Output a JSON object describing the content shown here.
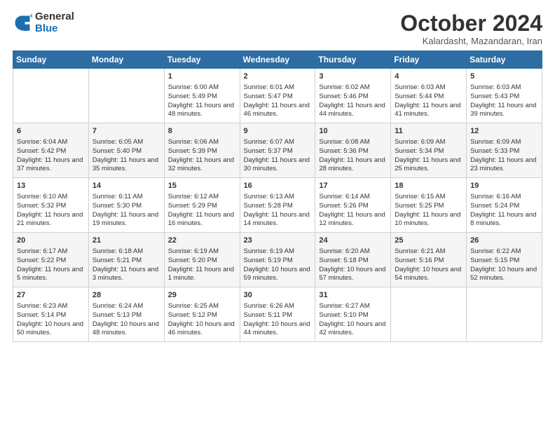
{
  "logo": {
    "general": "General",
    "blue": "Blue"
  },
  "header": {
    "month": "October 2024",
    "location": "Kalardasht, Mazandaran, Iran"
  },
  "weekdays": [
    "Sunday",
    "Monday",
    "Tuesday",
    "Wednesday",
    "Thursday",
    "Friday",
    "Saturday"
  ],
  "weeks": [
    [
      {
        "day": "",
        "sunrise": "",
        "sunset": "",
        "daylight": ""
      },
      {
        "day": "",
        "sunrise": "",
        "sunset": "",
        "daylight": ""
      },
      {
        "day": "1",
        "sunrise": "Sunrise: 6:00 AM",
        "sunset": "Sunset: 5:49 PM",
        "daylight": "Daylight: 11 hours and 48 minutes."
      },
      {
        "day": "2",
        "sunrise": "Sunrise: 6:01 AM",
        "sunset": "Sunset: 5:47 PM",
        "daylight": "Daylight: 11 hours and 46 minutes."
      },
      {
        "day": "3",
        "sunrise": "Sunrise: 6:02 AM",
        "sunset": "Sunset: 5:46 PM",
        "daylight": "Daylight: 11 hours and 44 minutes."
      },
      {
        "day": "4",
        "sunrise": "Sunrise: 6:03 AM",
        "sunset": "Sunset: 5:44 PM",
        "daylight": "Daylight: 11 hours and 41 minutes."
      },
      {
        "day": "5",
        "sunrise": "Sunrise: 6:03 AM",
        "sunset": "Sunset: 5:43 PM",
        "daylight": "Daylight: 11 hours and 39 minutes."
      }
    ],
    [
      {
        "day": "6",
        "sunrise": "Sunrise: 6:04 AM",
        "sunset": "Sunset: 5:42 PM",
        "daylight": "Daylight: 11 hours and 37 minutes."
      },
      {
        "day": "7",
        "sunrise": "Sunrise: 6:05 AM",
        "sunset": "Sunset: 5:40 PM",
        "daylight": "Daylight: 11 hours and 35 minutes."
      },
      {
        "day": "8",
        "sunrise": "Sunrise: 6:06 AM",
        "sunset": "Sunset: 5:39 PM",
        "daylight": "Daylight: 11 hours and 32 minutes."
      },
      {
        "day": "9",
        "sunrise": "Sunrise: 6:07 AM",
        "sunset": "Sunset: 5:37 PM",
        "daylight": "Daylight: 11 hours and 30 minutes."
      },
      {
        "day": "10",
        "sunrise": "Sunrise: 6:08 AM",
        "sunset": "Sunset: 5:36 PM",
        "daylight": "Daylight: 11 hours and 28 minutes."
      },
      {
        "day": "11",
        "sunrise": "Sunrise: 6:09 AM",
        "sunset": "Sunset: 5:34 PM",
        "daylight": "Daylight: 11 hours and 25 minutes."
      },
      {
        "day": "12",
        "sunrise": "Sunrise: 6:09 AM",
        "sunset": "Sunset: 5:33 PM",
        "daylight": "Daylight: 11 hours and 23 minutes."
      }
    ],
    [
      {
        "day": "13",
        "sunrise": "Sunrise: 6:10 AM",
        "sunset": "Sunset: 5:32 PM",
        "daylight": "Daylight: 11 hours and 21 minutes."
      },
      {
        "day": "14",
        "sunrise": "Sunrise: 6:11 AM",
        "sunset": "Sunset: 5:30 PM",
        "daylight": "Daylight: 11 hours and 19 minutes."
      },
      {
        "day": "15",
        "sunrise": "Sunrise: 6:12 AM",
        "sunset": "Sunset: 5:29 PM",
        "daylight": "Daylight: 11 hours and 16 minutes."
      },
      {
        "day": "16",
        "sunrise": "Sunrise: 6:13 AM",
        "sunset": "Sunset: 5:28 PM",
        "daylight": "Daylight: 11 hours and 14 minutes."
      },
      {
        "day": "17",
        "sunrise": "Sunrise: 6:14 AM",
        "sunset": "Sunset: 5:26 PM",
        "daylight": "Daylight: 11 hours and 12 minutes."
      },
      {
        "day": "18",
        "sunrise": "Sunrise: 6:15 AM",
        "sunset": "Sunset: 5:25 PM",
        "daylight": "Daylight: 11 hours and 10 minutes."
      },
      {
        "day": "19",
        "sunrise": "Sunrise: 6:16 AM",
        "sunset": "Sunset: 5:24 PM",
        "daylight": "Daylight: 11 hours and 8 minutes."
      }
    ],
    [
      {
        "day": "20",
        "sunrise": "Sunrise: 6:17 AM",
        "sunset": "Sunset: 5:22 PM",
        "daylight": "Daylight: 11 hours and 5 minutes."
      },
      {
        "day": "21",
        "sunrise": "Sunrise: 6:18 AM",
        "sunset": "Sunset: 5:21 PM",
        "daylight": "Daylight: 11 hours and 3 minutes."
      },
      {
        "day": "22",
        "sunrise": "Sunrise: 6:19 AM",
        "sunset": "Sunset: 5:20 PM",
        "daylight": "Daylight: 11 hours and 1 minute."
      },
      {
        "day": "23",
        "sunrise": "Sunrise: 6:19 AM",
        "sunset": "Sunset: 5:19 PM",
        "daylight": "Daylight: 10 hours and 59 minutes."
      },
      {
        "day": "24",
        "sunrise": "Sunrise: 6:20 AM",
        "sunset": "Sunset: 5:18 PM",
        "daylight": "Daylight: 10 hours and 57 minutes."
      },
      {
        "day": "25",
        "sunrise": "Sunrise: 6:21 AM",
        "sunset": "Sunset: 5:16 PM",
        "daylight": "Daylight: 10 hours and 54 minutes."
      },
      {
        "day": "26",
        "sunrise": "Sunrise: 6:22 AM",
        "sunset": "Sunset: 5:15 PM",
        "daylight": "Daylight: 10 hours and 52 minutes."
      }
    ],
    [
      {
        "day": "27",
        "sunrise": "Sunrise: 6:23 AM",
        "sunset": "Sunset: 5:14 PM",
        "daylight": "Daylight: 10 hours and 50 minutes."
      },
      {
        "day": "28",
        "sunrise": "Sunrise: 6:24 AM",
        "sunset": "Sunset: 5:13 PM",
        "daylight": "Daylight: 10 hours and 48 minutes."
      },
      {
        "day": "29",
        "sunrise": "Sunrise: 6:25 AM",
        "sunset": "Sunset: 5:12 PM",
        "daylight": "Daylight: 10 hours and 46 minutes."
      },
      {
        "day": "30",
        "sunrise": "Sunrise: 6:26 AM",
        "sunset": "Sunset: 5:11 PM",
        "daylight": "Daylight: 10 hours and 44 minutes."
      },
      {
        "day": "31",
        "sunrise": "Sunrise: 6:27 AM",
        "sunset": "Sunset: 5:10 PM",
        "daylight": "Daylight: 10 hours and 42 minutes."
      },
      {
        "day": "",
        "sunrise": "",
        "sunset": "",
        "daylight": ""
      },
      {
        "day": "",
        "sunrise": "",
        "sunset": "",
        "daylight": ""
      }
    ]
  ]
}
